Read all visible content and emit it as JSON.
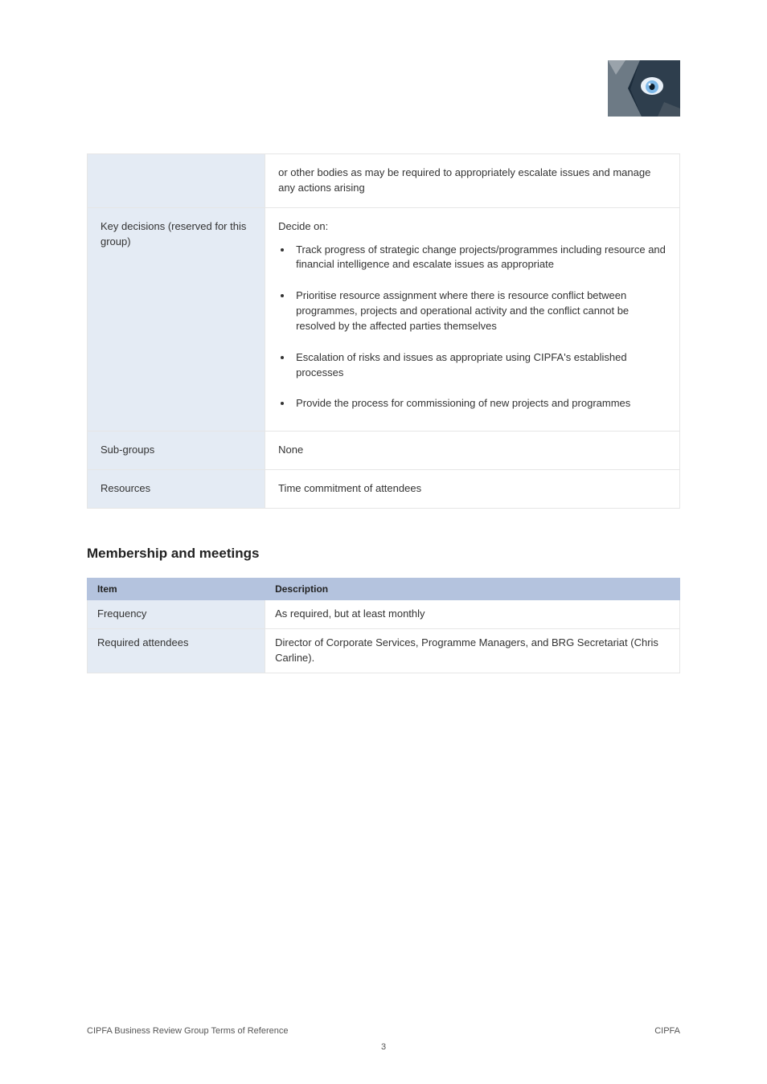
{
  "logo_alt": "wolf-eye-logo",
  "table1": {
    "rows": [
      {
        "label": "",
        "text": "or other bodies as may be required to appropriately escalate issues and manage any actions arising"
      },
      {
        "label": "Key decisions (reserved for this group)",
        "intro": "Decide on:",
        "bullets": [
          "Track progress of strategic change projects/programmes including resource and financial intelligence and escalate issues as appropriate",
          "Prioritise resource assignment where there is resource conflict between programmes, projects and operational activity and the conflict cannot be resolved by the affected parties themselves",
          "Escalation of risks and issues as appropriate using CIPFA's established processes",
          "Provide the process for commissioning of new projects and programmes"
        ]
      },
      {
        "label": "Sub-groups",
        "text": "None"
      },
      {
        "label": "Resources",
        "text": "Time commitment of attendees"
      }
    ]
  },
  "section2": {
    "heading": "Membership and meetings",
    "headers": [
      "Item",
      "Description"
    ],
    "rows": [
      {
        "label": "Frequency",
        "text": "As required, but at least monthly"
      },
      {
        "label": "Required attendees",
        "text": "Director of Corporate Services, Programme Managers, and BRG Secretariat (Chris Carline)."
      }
    ]
  },
  "footer": {
    "left": "CIPFA Business Review Group Terms of Reference",
    "right": "CIPFA",
    "page": "3"
  }
}
